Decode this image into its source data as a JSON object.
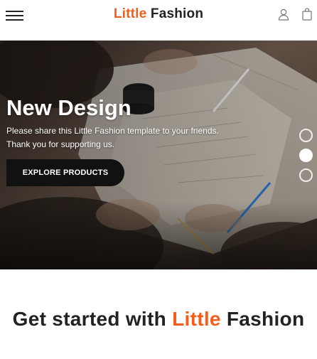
{
  "navbar": {
    "brand_accent": "Little",
    "brand_rest": "Fashion",
    "menu_icon": "hamburger-menu-icon",
    "user_icon": "user-icon",
    "bag_icon": "shopping-bag-icon"
  },
  "hero": {
    "title": "New Design",
    "text_line1": "Please share this Little Fashion template to your friends.",
    "text_line2": "Thank you for supporting us.",
    "cta_label": "EXPLORE PRODUCTS",
    "slides": [
      {
        "active": false
      },
      {
        "active": true
      },
      {
        "active": false
      }
    ]
  },
  "section": {
    "title_prefix": "Get started with",
    "title_accent": "Little",
    "title_suffix": "Fashion"
  },
  "colors": {
    "accent": "#f65d1c",
    "text": "#222222",
    "cta_bg": "#111111"
  }
}
